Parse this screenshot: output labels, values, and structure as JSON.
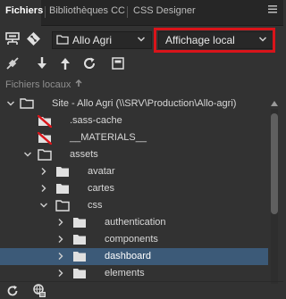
{
  "tabs": [
    {
      "label": "Fichiers",
      "active": true
    },
    {
      "label": "Bibliothèques CC",
      "active": false
    },
    {
      "label": "CSS Designer",
      "active": false
    }
  ],
  "icons": {
    "panel_menu": "panel-menu-icon",
    "connect": "connect-to-server-icon",
    "git": "git-icon",
    "site_folder": "site-folder-icon",
    "disconnect": "disconnect-icon",
    "get": "get-files-icon",
    "put": "put-files-icon",
    "refresh": "refresh-icon",
    "expand": "expand-view-icon",
    "sync": "sync-icon",
    "log": "log-icon"
  },
  "site_select": {
    "value": "Allo Agri"
  },
  "view_select": {
    "value": "Affichage local"
  },
  "local_files": {
    "label": "Fichiers locaux"
  },
  "tree": [
    {
      "level": 0,
      "label": "Site - Allo Agri (\\\\SRV\\Production\\Allo-agri)",
      "type": "site",
      "expanded": true
    },
    {
      "level": 1,
      "label": ".sass-cache",
      "type": "folder-excluded"
    },
    {
      "level": 1,
      "label": "__MATERIALS__",
      "type": "folder-excluded"
    },
    {
      "level": 1,
      "label": "assets",
      "type": "folder",
      "expanded": true
    },
    {
      "level": 2,
      "label": "avatar",
      "type": "folder",
      "expanded": false
    },
    {
      "level": 2,
      "label": "cartes",
      "type": "folder",
      "expanded": false
    },
    {
      "level": 2,
      "label": "css",
      "type": "folder",
      "expanded": true
    },
    {
      "level": 3,
      "label": "authentication",
      "type": "folder",
      "expanded": false
    },
    {
      "level": 3,
      "label": "components",
      "type": "folder",
      "expanded": false
    },
    {
      "level": 3,
      "label": "dashboard",
      "type": "folder",
      "expanded": false,
      "selected": true
    },
    {
      "level": 3,
      "label": "elements",
      "type": "folder",
      "expanded": false
    }
  ],
  "colors": {
    "background": "#323232",
    "selection": "#3c5a78",
    "highlight_frame": "#d9141a",
    "excluded_marker": "#d9141a"
  }
}
